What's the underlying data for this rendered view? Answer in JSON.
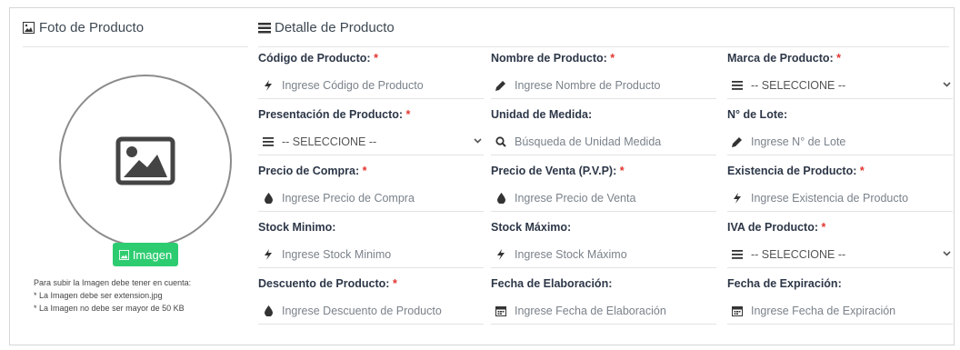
{
  "left_panel": {
    "title": "Foto de Producto",
    "image_button": "Imagen",
    "notes": [
      "Para subir la Imagen debe tener en cuenta:",
      "* La Imagen debe ser extension.jpg",
      "* La Imagen no debe ser mayor de 50 KB"
    ]
  },
  "right_panel": {
    "title": "Detalle de Producto",
    "fields": [
      {
        "label": "Código de Producto:",
        "required": "*",
        "placeholder": "Ingrese Código de Producto",
        "icon": "bolt-icon"
      },
      {
        "label": "Nombre de Producto:",
        "required": "*",
        "placeholder": "Ingrese Nombre de Producto",
        "icon": "pencil-icon"
      },
      {
        "label": "Marca de Producto:",
        "required": "*",
        "placeholder": "-- SELECCIONE --",
        "icon": "list-icon",
        "select": true
      },
      {
        "label": "Presentación de Producto:",
        "required": "*",
        "placeholder": "-- SELECCIONE --",
        "icon": "list-icon",
        "select": true
      },
      {
        "label": "Unidad de Medida:",
        "required": "",
        "placeholder": "Búsqueda de Unidad Medida",
        "icon": "search-icon"
      },
      {
        "label": "N° de Lote:",
        "required": "",
        "placeholder": "Ingrese N° de Lote",
        "icon": "pencil-icon"
      },
      {
        "label": "Precio de Compra:",
        "required": "*",
        "placeholder": "Ingrese Precio de Compra",
        "icon": "drop-icon"
      },
      {
        "label": "Precio de Venta (P.V.P):",
        "required": "*",
        "placeholder": "Ingrese Precio de Venta",
        "icon": "drop-icon"
      },
      {
        "label": "Existencia de Producto:",
        "required": "*",
        "placeholder": "Ingrese Existencia de Producto",
        "icon": "bolt-icon"
      },
      {
        "label": "Stock Minimo:",
        "required": "",
        "placeholder": "Ingrese Stock Minimo",
        "icon": "bolt-icon"
      },
      {
        "label": "Stock Máximo:",
        "required": "",
        "placeholder": "Ingrese Stock Máximo",
        "icon": "bolt-icon"
      },
      {
        "label": "IVA de Producto:",
        "required": "*",
        "placeholder": "-- SELECCIONE --",
        "icon": "list-icon",
        "select": true
      },
      {
        "label": "Descuento de Producto:",
        "required": "*",
        "placeholder": "Ingrese Descuento de Producto",
        "icon": "drop-icon"
      },
      {
        "label": "Fecha de Elaboración:",
        "required": "",
        "placeholder": "Ingrese Fecha de Elaboración",
        "icon": "calendar-icon"
      },
      {
        "label": "Fecha de Expiración:",
        "required": "",
        "placeholder": "Ingrese Fecha de Expiración",
        "icon": "calendar-icon"
      }
    ]
  }
}
